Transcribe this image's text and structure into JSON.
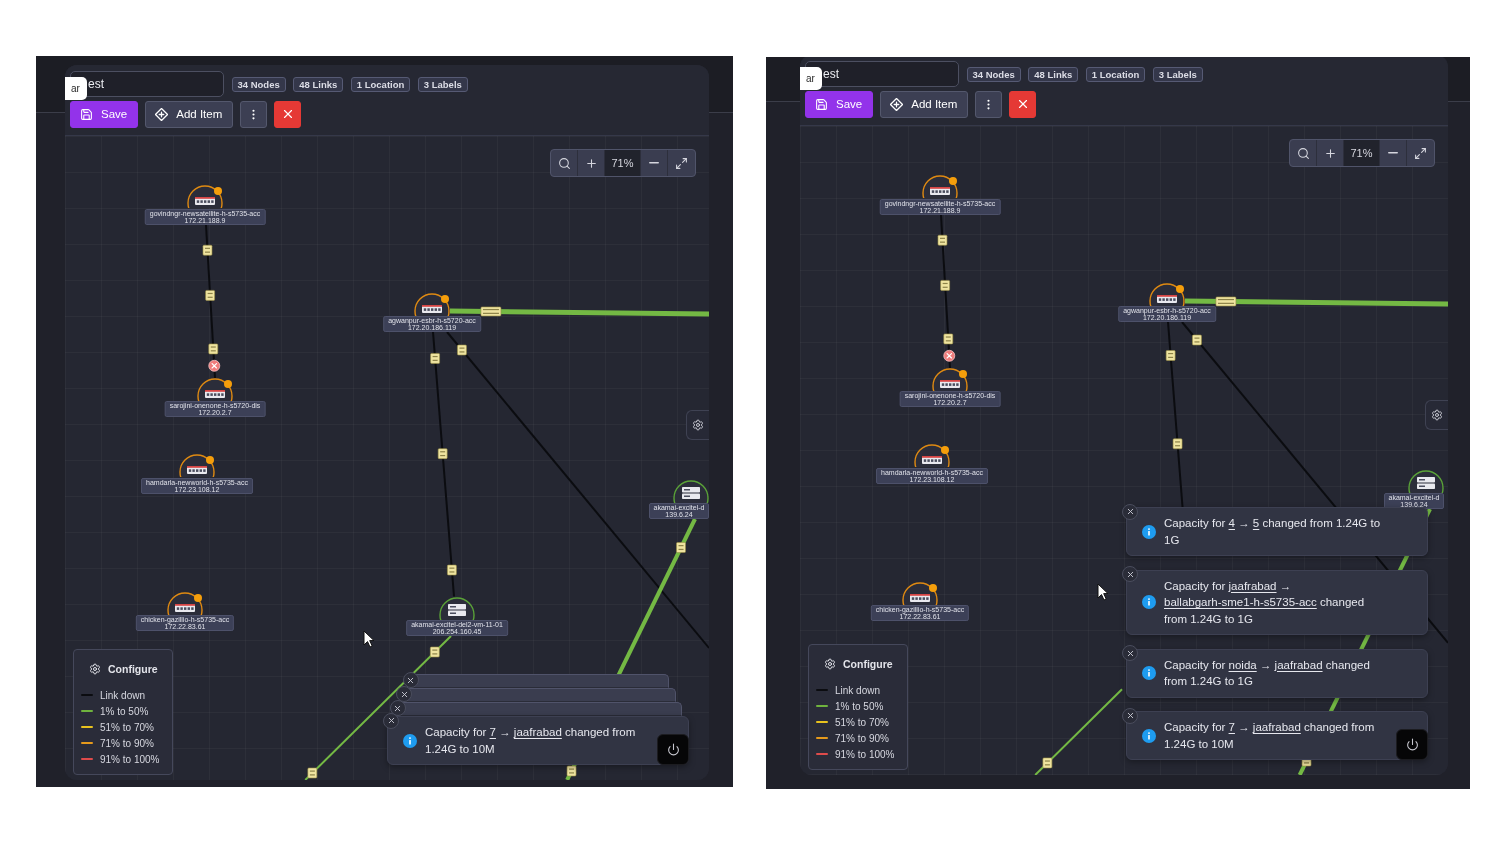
{
  "panels": [
    {
      "search": {
        "value": "est"
      },
      "tooltip": "ar",
      "badges": [
        "34 Nodes",
        "48 Links",
        "1 Location",
        "3 Labels"
      ],
      "actions": [
        {
          "kind": "save",
          "label": "Save"
        },
        {
          "kind": "add",
          "label": "Add Item"
        },
        {
          "kind": "more"
        },
        {
          "kind": "close"
        }
      ],
      "zoom": {
        "value": "71%"
      },
      "nodes": [
        {
          "kind": "switch",
          "name": "govindngr-newsatellite-h-s5735-acc",
          "ip": "172.21.188.9",
          "alert": true
        },
        {
          "kind": "switch",
          "name": "agwanpur-esbr-h-s5720-acc",
          "ip": "172.20.186.119",
          "alert": true
        },
        {
          "kind": "switch",
          "name": "sarojini-onenone-h-s5720-dis",
          "ip": "172.20.2.7",
          "alert": true
        },
        {
          "kind": "switch",
          "name": "hamdarla-newworld-h-s5735-acc",
          "ip": "172.23.108.12",
          "alert": true
        },
        {
          "kind": "server",
          "name": "akamai-excitel-d",
          "ip": "139.6.24",
          "alert": false
        },
        {
          "kind": "switch",
          "name": "chicken-gazillio-h-s5735-acc",
          "ip": "172.22.83.61",
          "alert": true
        },
        {
          "kind": "server",
          "name": "akamai-excitel-del2-vm-11-01",
          "ip": "206.254.160.45",
          "alert": false
        }
      ],
      "links": [
        {
          "color": "#0b0c10",
          "fault": true
        },
        {
          "color": "#74b944",
          "fault": false
        },
        {
          "color": "#0b0c10",
          "fault": false
        },
        {
          "color": "#0b0c10",
          "fault": false
        },
        {
          "color": "#74b944",
          "fault": false
        },
        {
          "color": "#74b944",
          "fault": false
        }
      ],
      "legend": {
        "button": "Configure",
        "items": [
          {
            "label": "Link down",
            "color": "#0b0c10"
          },
          {
            "label": "1% to 50%",
            "color": "#6fb33e"
          },
          {
            "label": "51% to 70%",
            "color": "#e8c21e"
          },
          {
            "label": "71% to 90%",
            "color": "#e69a1c"
          },
          {
            "label": "91% to 100%",
            "color": "#de4b4b"
          }
        ]
      },
      "toasts": [
        {
          "expanded": false
        },
        {
          "expanded": false
        },
        {
          "expanded": false
        },
        {
          "expanded": true,
          "segments": [
            {
              "kind": "text",
              "text": "Capacity for "
            },
            {
              "kind": "link",
              "text": "7"
            },
            {
              "kind": "text",
              "text": " → "
            },
            {
              "kind": "link",
              "text": "jaafrabad"
            },
            {
              "kind": "text",
              "text": " changed from 1.24G to 10M"
            }
          ]
        }
      ]
    },
    {
      "search": {
        "value": "est"
      },
      "tooltip": "ar",
      "badges": [
        "34 Nodes",
        "48 Links",
        "1 Location",
        "3 Labels"
      ],
      "actions": [
        {
          "kind": "save",
          "label": "Save"
        },
        {
          "kind": "add",
          "label": "Add Item"
        },
        {
          "kind": "more"
        },
        {
          "kind": "close"
        }
      ],
      "zoom": {
        "value": "71%"
      },
      "nodes": [
        {
          "kind": "switch",
          "name": "govindngr-newsatellite-h-s5735-acc",
          "ip": "172.21.188.9",
          "alert": true
        },
        {
          "kind": "switch",
          "name": "agwanpur-esbr-h-s5720-acc",
          "ip": "172.20.186.119",
          "alert": true
        },
        {
          "kind": "switch",
          "name": "sarojini-onenone-h-s5720-dis",
          "ip": "172.20.2.7",
          "alert": true
        },
        {
          "kind": "switch",
          "name": "hamdarla-newworld-h-s5735-acc",
          "ip": "172.23.108.12",
          "alert": true
        },
        {
          "kind": "server",
          "name": "akamai-excitel-d",
          "ip": "139.6.24",
          "alert": false
        },
        {
          "kind": "switch",
          "name": "chicken-gazillio-h-s5735-acc",
          "ip": "172.22.83.61",
          "alert": true
        }
      ],
      "links": [
        {
          "color": "#0b0c10",
          "fault": true
        },
        {
          "color": "#74b944",
          "fault": false
        },
        {
          "color": "#0b0c10",
          "fault": false
        },
        {
          "color": "#0b0c10",
          "fault": false
        },
        {
          "color": "#74b944",
          "fault": false
        },
        {
          "color": "#74b944",
          "fault": false
        }
      ],
      "legend": {
        "button": "Configure",
        "items": [
          {
            "label": "Link down",
            "color": "#0b0c10"
          },
          {
            "label": "1% to 50%",
            "color": "#6fb33e"
          },
          {
            "label": "51% to 70%",
            "color": "#e8c21e"
          },
          {
            "label": "71% to 90%",
            "color": "#e69a1c"
          },
          {
            "label": "91% to 100%",
            "color": "#de4b4b"
          }
        ]
      },
      "toasts": [
        {
          "expanded": true,
          "segments": [
            {
              "kind": "text",
              "text": "Capacity for "
            },
            {
              "kind": "link",
              "text": "4"
            },
            {
              "kind": "text",
              "text": " → "
            },
            {
              "kind": "link",
              "text": "5"
            },
            {
              "kind": "text",
              "text": " changed from 1.24G to 1G"
            }
          ]
        },
        {
          "expanded": true,
          "segments": [
            {
              "kind": "text",
              "text": "Capacity for "
            },
            {
              "kind": "link",
              "text": "jaafrabad"
            },
            {
              "kind": "text",
              "text": " → "
            },
            {
              "kind": "link",
              "text": "ballabgarh-sme1-h-s5735-acc"
            },
            {
              "kind": "text",
              "text": " changed from 1.24G to 1G"
            }
          ]
        },
        {
          "expanded": true,
          "segments": [
            {
              "kind": "text",
              "text": "Capacity for "
            },
            {
              "kind": "link",
              "text": "noida"
            },
            {
              "kind": "text",
              "text": " → "
            },
            {
              "kind": "link",
              "text": "jaafrabad"
            },
            {
              "kind": "text",
              "text": " changed from 1.24G to 1G"
            }
          ]
        },
        {
          "expanded": true,
          "segments": [
            {
              "kind": "text",
              "text": "Capacity for "
            },
            {
              "kind": "link",
              "text": "7"
            },
            {
              "kind": "text",
              "text": " → "
            },
            {
              "kind": "link",
              "text": "jaafrabad"
            },
            {
              "kind": "text",
              "text": " changed from 1.24G to 10M"
            }
          ]
        }
      ]
    }
  ]
}
